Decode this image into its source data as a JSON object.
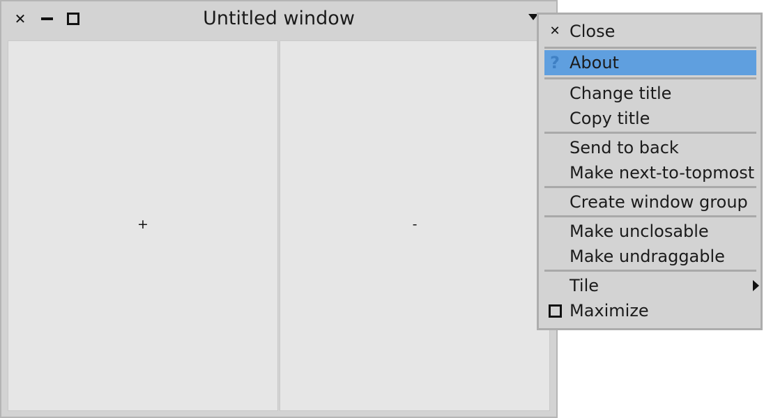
{
  "window": {
    "title": "Untitled window",
    "panes": [
      {
        "label": "+"
      },
      {
        "label": "-"
      }
    ]
  },
  "menu": {
    "items": [
      {
        "label": "Close",
        "icon": "close-icon"
      },
      {
        "label": "About",
        "icon": "help-icon",
        "glyph": "?",
        "selected": true
      },
      {
        "label": "Change title"
      },
      {
        "label": "Copy title"
      },
      {
        "label": "Send to back"
      },
      {
        "label": "Make next-to-topmost"
      },
      {
        "label": "Create window group"
      },
      {
        "label": "Make unclosable"
      },
      {
        "label": "Make undraggable"
      },
      {
        "label": "Tile",
        "icon": "submenu-arrow-icon"
      },
      {
        "label": "Maximize",
        "icon": "maximize-icon"
      }
    ]
  },
  "colors": {
    "selection": "#5f9fdf",
    "window_bg": "#d3d3d3",
    "pane_bg": "#e6e6e6"
  }
}
